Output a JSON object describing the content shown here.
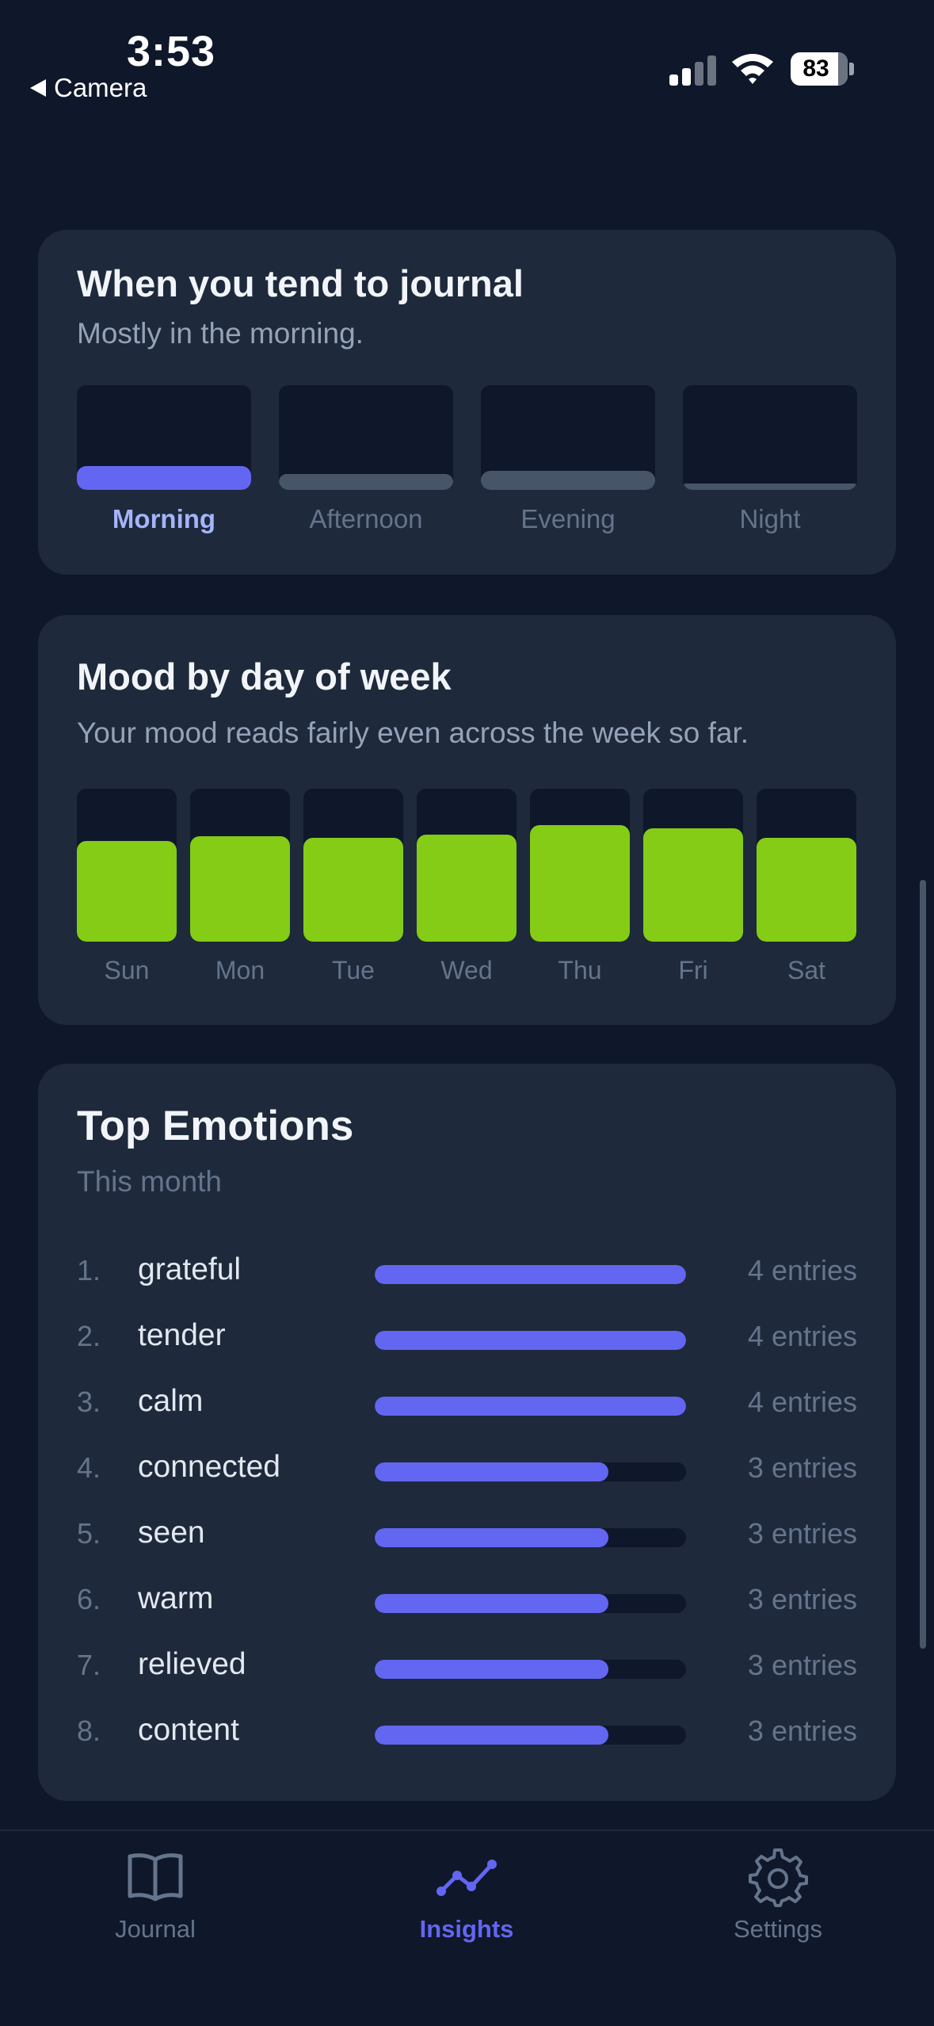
{
  "status_bar": {
    "time": "3:53",
    "back_app": "Camera",
    "battery": "83"
  },
  "time_of_day": {
    "title": "When you tend to journal",
    "subtitle": "Mostly in the morning.",
    "slots": [
      {
        "label": "Morning",
        "level": 0.23,
        "color": "#6366f1",
        "active": true
      },
      {
        "label": "Afternoon",
        "level": 0.15,
        "color": "#475569",
        "active": false
      },
      {
        "label": "Evening",
        "level": 0.18,
        "color": "#475569",
        "active": false
      },
      {
        "label": "Night",
        "level": 0.06,
        "color": "#475569",
        "active": false
      }
    ]
  },
  "mood_by_day": {
    "title": "Mood by day of week",
    "subtitle": "Your mood reads fairly even across the week so far.",
    "bar_color": "#84cc16",
    "days": [
      {
        "label": "Sun",
        "level": 0.66
      },
      {
        "label": "Mon",
        "level": 0.69
      },
      {
        "label": "Tue",
        "level": 0.68
      },
      {
        "label": "Wed",
        "level": 0.7
      },
      {
        "label": "Thu",
        "level": 0.76
      },
      {
        "label": "Fri",
        "level": 0.74
      },
      {
        "label": "Sat",
        "level": 0.68
      }
    ]
  },
  "top_emotions": {
    "title": "Top Emotions",
    "subtitle": "This month",
    "bar_color": "#6366f1",
    "items": [
      {
        "rank": "1.",
        "name": "grateful",
        "count": "4 entries",
        "value": 4
      },
      {
        "rank": "2.",
        "name": "tender",
        "count": "4 entries",
        "value": 4
      },
      {
        "rank": "3.",
        "name": "calm",
        "count": "4 entries",
        "value": 4
      },
      {
        "rank": "4.",
        "name": "connected",
        "count": "3 entries",
        "value": 3
      },
      {
        "rank": "5.",
        "name": "seen",
        "count": "3 entries",
        "value": 3
      },
      {
        "rank": "6.",
        "name": "warm",
        "count": "3 entries",
        "value": 3
      },
      {
        "rank": "7.",
        "name": "relieved",
        "count": "3 entries",
        "value": 3
      },
      {
        "rank": "8.",
        "name": "content",
        "count": "3 entries",
        "value": 3
      }
    ],
    "max_value": 4
  },
  "tabs": [
    {
      "label": "Journal",
      "icon": "book-icon",
      "active": false
    },
    {
      "label": "Insights",
      "icon": "trend-line-icon",
      "active": true
    },
    {
      "label": "Settings",
      "icon": "gear-icon",
      "active": false
    }
  ],
  "colors": {
    "accent": "#6366f1",
    "mood": "#84cc16",
    "background": "#0f172a",
    "card": "#1e293b"
  }
}
